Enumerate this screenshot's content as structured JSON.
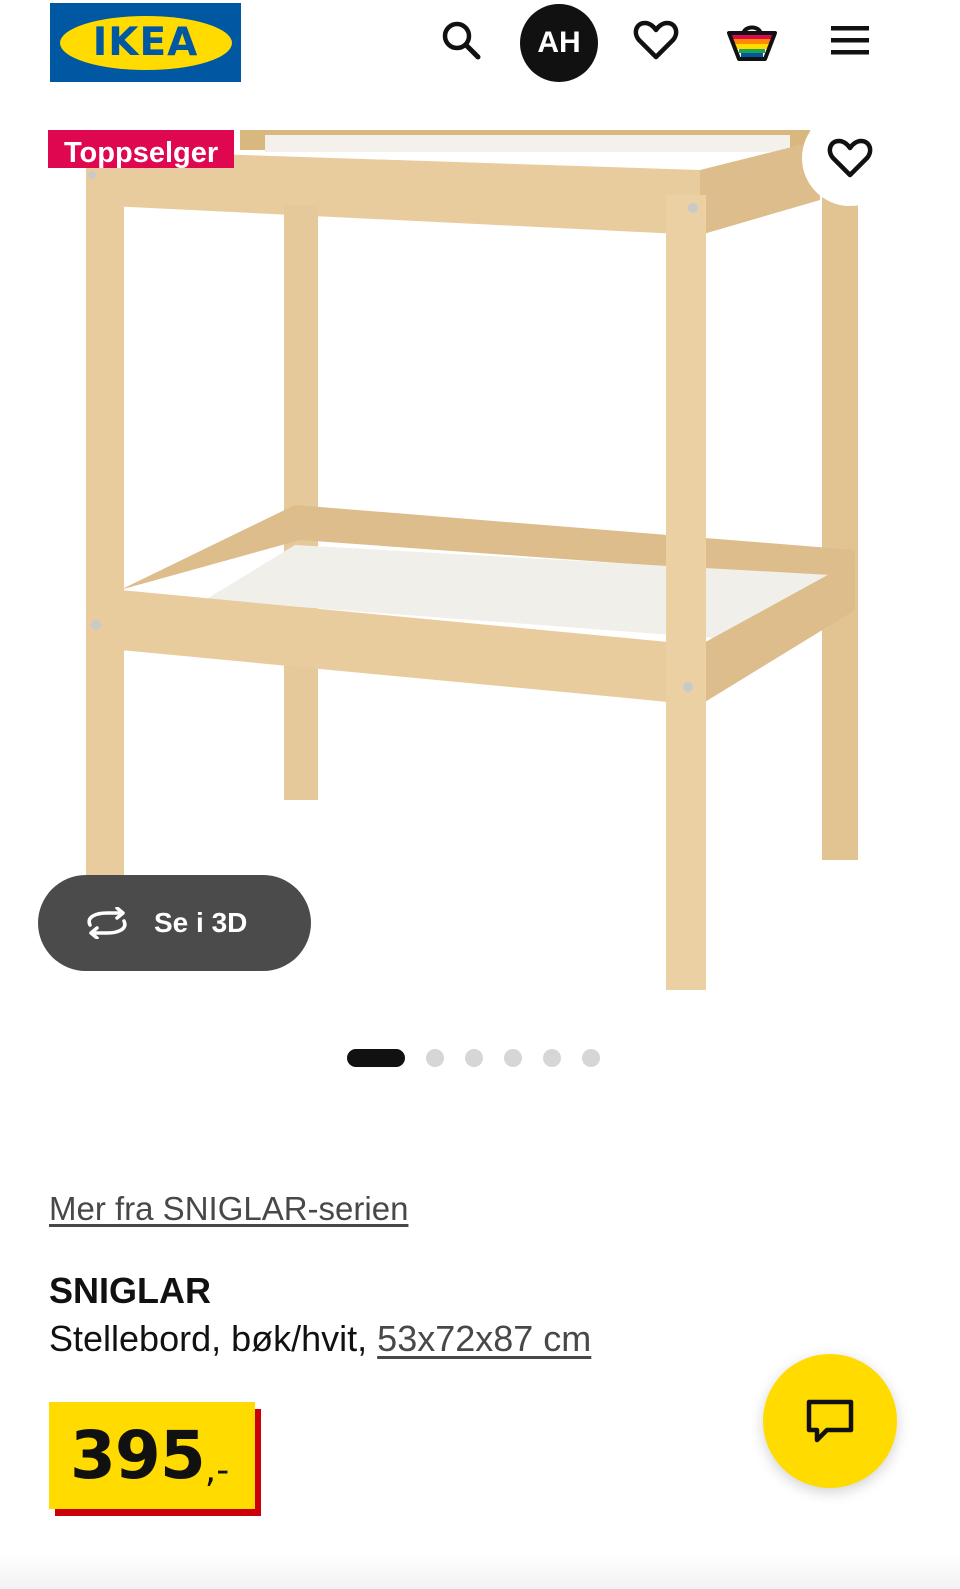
{
  "header": {
    "logo_text": "IKEA",
    "avatar_initials": "AH",
    "icons": [
      "search-icon",
      "avatar",
      "heart-icon",
      "basket-icon",
      "menu-icon"
    ]
  },
  "product_image": {
    "badge": "Toppselger",
    "view_3d_label": "Se i 3D",
    "carousel": {
      "count": 6,
      "active_index": 0
    }
  },
  "product": {
    "series_link": "Mer fra SNIGLAR-serien",
    "name": "SNIGLAR",
    "description": "Stellebord, bøk/hvit,",
    "dimensions": "53x72x87 cm",
    "price": "395",
    "price_suffix": ",-"
  },
  "colors": {
    "ikea_blue": "#0058a3",
    "ikea_yellow": "#ffdb00",
    "badge_red": "#e00751",
    "price_shadow": "#cc0008",
    "wood": "#e8cc9e"
  }
}
